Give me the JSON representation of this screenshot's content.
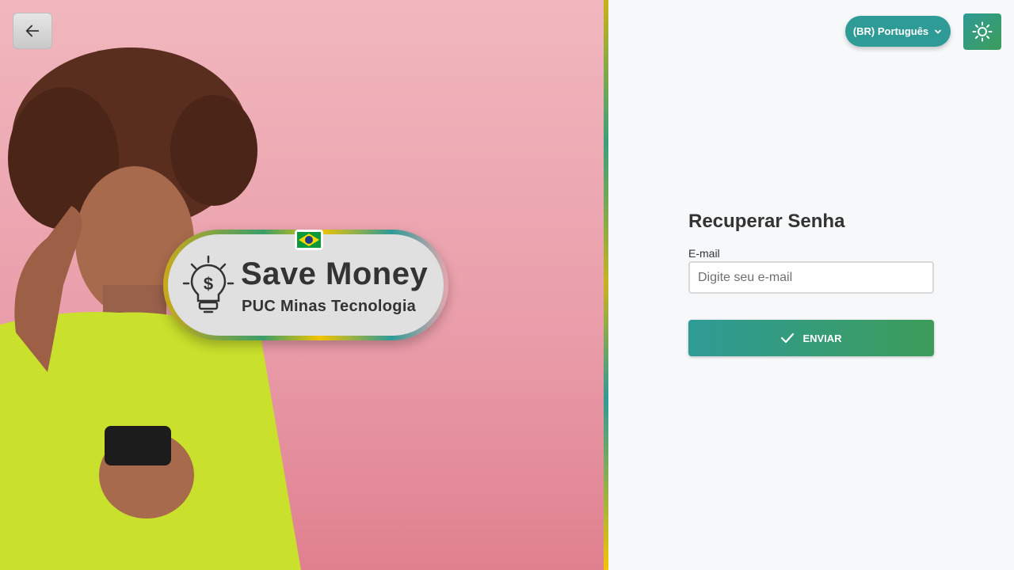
{
  "header": {
    "back_icon": "arrow-left-icon",
    "language_label": "(BR) Português",
    "language_icon": "chevron-down-icon",
    "theme_icon": "sun-icon"
  },
  "hero": {
    "logo_title": "Save Money",
    "logo_subtitle": "PUC Minas Tecnologia",
    "logo_icon": "lightbulb-dollar-icon",
    "flag_icon": "brazil-flag-icon"
  },
  "form": {
    "title": "Recuperar Senha",
    "email_label": "E-mail",
    "email_value": "",
    "email_placeholder": "Digite seu e-mail",
    "submit_label": "ENVIAR",
    "submit_icon": "check-icon"
  },
  "colors": {
    "accent_teal": "#2e9b96",
    "accent_green": "#3d9c5a",
    "hero_pink": "#f1b7be"
  }
}
